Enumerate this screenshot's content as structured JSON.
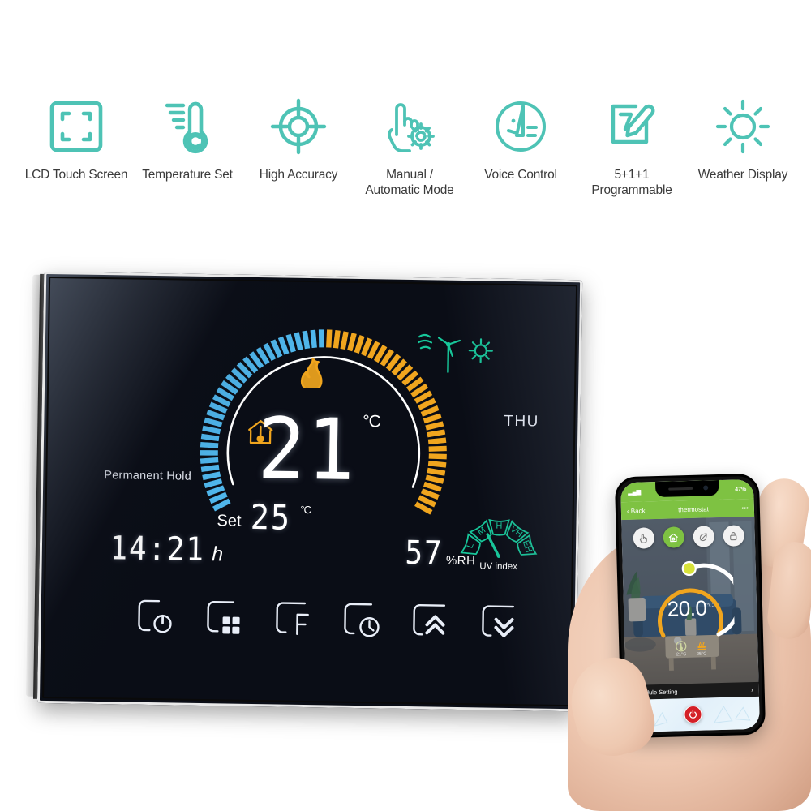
{
  "features": [
    {
      "icon": "lcd-touch-screen-icon",
      "label": "LCD Touch Screen"
    },
    {
      "icon": "thermometer-icon",
      "label": "Temperature Set"
    },
    {
      "icon": "target-crosshair-icon",
      "label": "High Accuracy"
    },
    {
      "icon": "hand-gear-icon",
      "label": "Manual /\nAutomatic Mode"
    },
    {
      "icon": "voice-control-icon",
      "label": "Voice Control"
    },
    {
      "icon": "pencil-note-icon",
      "label": "5+1+1\nProgrammable"
    },
    {
      "icon": "sun-icon",
      "label": "Weather Display"
    }
  ],
  "thermostat": {
    "current_temp": "21",
    "current_unit": "°C",
    "set_label": "Set",
    "set_temp": "25",
    "set_unit": "°C",
    "mode_text": "Permanent Hold",
    "day": "THU",
    "time": "14:21",
    "time_unit": "h",
    "humidity": "57",
    "humidity_unit": "%RH",
    "uv_label": "UV index",
    "uv_segments": [
      "L",
      "M",
      "H",
      "VH",
      "EH"
    ],
    "indicators": [
      "flame-icon",
      "house-thermometer-icon",
      "wind-turbine-icon",
      "sun-icon"
    ],
    "buttons": [
      {
        "name": "power-button",
        "glyph": "power"
      },
      {
        "name": "menu-button",
        "glyph": "grid"
      },
      {
        "name": "fahrenheit-button",
        "glyph": "F"
      },
      {
        "name": "clock-button",
        "glyph": "clock"
      },
      {
        "name": "temp-up-button",
        "glyph": "chevron-up"
      },
      {
        "name": "temp-down-button",
        "glyph": "chevron-down"
      }
    ],
    "colors": {
      "cool_ticks": "#4fb6ec",
      "heat_ticks": "#f0a51e",
      "accent_green": "#17c79a",
      "screen_bg": "#0a0d16",
      "digit": "#ffffff"
    }
  },
  "phone": {
    "status_battery": "47%",
    "back_label": "Back",
    "app_title": "thermostat",
    "menu_glyph": "•••",
    "temperature": "20.0",
    "temperature_unit": "°C",
    "modes": [
      {
        "name": "manual-mode-button",
        "icon": "hand-icon",
        "active": false
      },
      {
        "name": "home-mode-button",
        "icon": "home-icon",
        "active": true
      },
      {
        "name": "eco-mode-button",
        "icon": "leaf-icon",
        "active": false
      },
      {
        "name": "lock-button",
        "icon": "lock-icon",
        "active": false
      }
    ],
    "mini_readings": [
      {
        "icon": "thermometer-icon",
        "value": "21°C"
      },
      {
        "icon": "heat-icon",
        "value": "25°C"
      }
    ],
    "schedule_label": "Schedule Setting",
    "schedule_chevron": "›",
    "power_icon": "power-icon",
    "accent_green": "#7ec242",
    "power_red": "#d42027"
  }
}
